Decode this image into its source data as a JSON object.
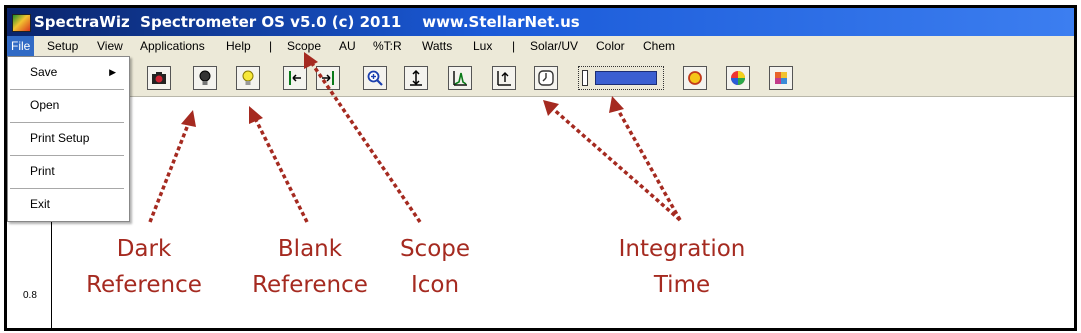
{
  "window": {
    "title": "SpectraWiz  Spectrometer OS v5.0 (c) 2011    www.StellarNet.us"
  },
  "menubar": {
    "items": [
      "File",
      "Setup",
      "View",
      "Applications",
      "Help",
      "|",
      "Scope",
      "AU",
      "%T:R",
      "Watts",
      "Lux",
      "|",
      "Solar/UV",
      "Color",
      "Chem"
    ]
  },
  "file_menu": {
    "items": [
      "Save",
      "Open",
      "Print Setup",
      "Print",
      "Exit"
    ],
    "submenu_arrow": "▶"
  },
  "toolbar": {
    "buttons": [
      "camera-icon",
      "dark-bulb-icon",
      "light-bulb-icon",
      "left-bracket-icon",
      "right-bracket-icon",
      "zoom-icon",
      "scale-y-icon",
      "peak-icon",
      "autoscale-icon",
      "integration-clock-icon",
      "sun-icon",
      "color-wheel-icon",
      "palette-icon"
    ]
  },
  "graph": {
    "y_tick": "0.8"
  },
  "annotations": {
    "dark": "Dark\nReference",
    "blank": "Blank\nReference",
    "scope": "Scope\nIcon",
    "integration": "Integration\nTime"
  },
  "colors": {
    "titlebar": "#0a246a",
    "annotation": "#a52a20",
    "integration_bar": "#3b5fd1",
    "menu_highlight": "#316ac5"
  }
}
